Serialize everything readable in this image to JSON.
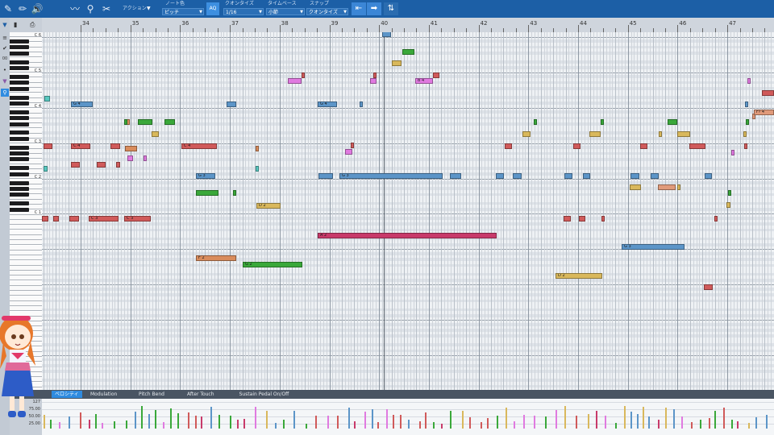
{
  "toolbar": {
    "icons": [
      "tool-icon",
      "pencil-icon",
      "speaker-icon",
      "wave-icon",
      "magnifier-icon",
      "scissors-icon"
    ],
    "action_label": "アクション",
    "note_color_label": "ノート色",
    "note_color_value": "ピッチ",
    "aq_label": "AQ",
    "quantize_label": "クオンタイズ",
    "quantize_value": "1/16",
    "timebase_label": "タイムベース",
    "timebase_value": "小節",
    "snap_label": "スナップ",
    "snap_value": "クオンタイズ"
  },
  "left_strip": {
    "zoom_value": "00"
  },
  "ruler": {
    "bars": [
      "34",
      "35",
      "36",
      "37",
      "38",
      "39",
      "40",
      "41",
      "42",
      "43",
      "44",
      "45",
      "46",
      "47"
    ]
  },
  "keyboard": {
    "octave_labels": [
      "C 6",
      "C 5",
      "C 4",
      "C 3",
      "C 2",
      "C 1"
    ]
  },
  "notes": [
    {
      "label": "A 2",
      "color": "#c83a6a"
    },
    {
      "label": "F 2",
      "color": "#d98c5c"
    },
    {
      "label": "G 2",
      "color": "#3aa83a"
    },
    {
      "label": "D 2",
      "color": "#d9b85c"
    },
    {
      "label": "G 3",
      "color": "#5c95c8"
    },
    {
      "label": "C 3",
      "color": "#d05a5a"
    },
    {
      "label": "C 4",
      "color": "#d05a5a"
    },
    {
      "label": "G 4",
      "color": "#5c95c8"
    },
    {
      "label": "B 4",
      "color": "#e07ae0"
    },
    {
      "label": "F♯ 4",
      "color": "#e09a7a"
    }
  ],
  "velocity_tabs": [
    "ベロシティ",
    "Modulation",
    "Pitch Bend",
    "After Touch",
    "Sustain Pedal On/Off"
  ],
  "velocity_scale": [
    "127",
    "75.00",
    "50.00",
    "25.00"
  ],
  "playhead_bar": "40"
}
